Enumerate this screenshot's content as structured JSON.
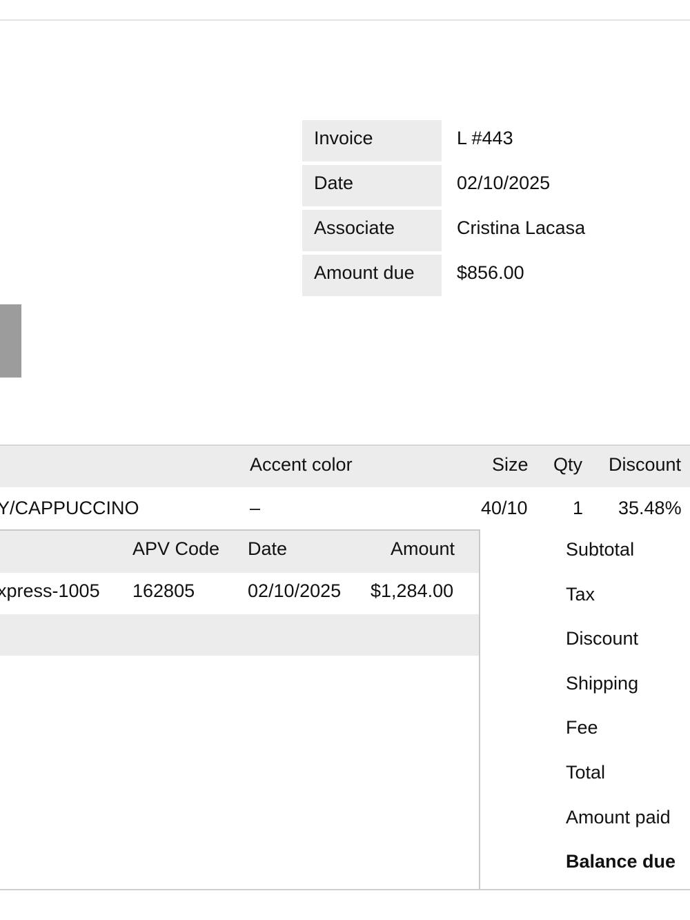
{
  "invoice_meta": [
    {
      "label": "Invoice",
      "value": "L #443"
    },
    {
      "label": "Date",
      "value": "02/10/2025"
    },
    {
      "label": "Associate",
      "value": "Cristina Lacasa"
    },
    {
      "label": "Amount due",
      "value": "$856.00"
    }
  ],
  "items": {
    "headers": {
      "accent_color": "Accent color",
      "size": "Size",
      "qty": "Qty",
      "discount": "Discount"
    },
    "rows": [
      {
        "item": "Y/CAPPUCCINO",
        "accent_color": "–",
        "size": "40/10",
        "qty": "1",
        "discount": "35.48%"
      }
    ]
  },
  "payments": {
    "headers": {
      "apv_code": "APV Code",
      "date": "Date",
      "amount": "Amount"
    },
    "rows": [
      {
        "method": "xpress-1005",
        "apv_code": "162805",
        "date": "02/10/2025",
        "amount": "$1,284.00"
      }
    ]
  },
  "totals": {
    "labels": [
      "Subtotal",
      "Tax",
      "Discount",
      "Shipping",
      "Fee",
      "Total",
      "Amount paid"
    ],
    "balance_due_label": "Balance due"
  }
}
